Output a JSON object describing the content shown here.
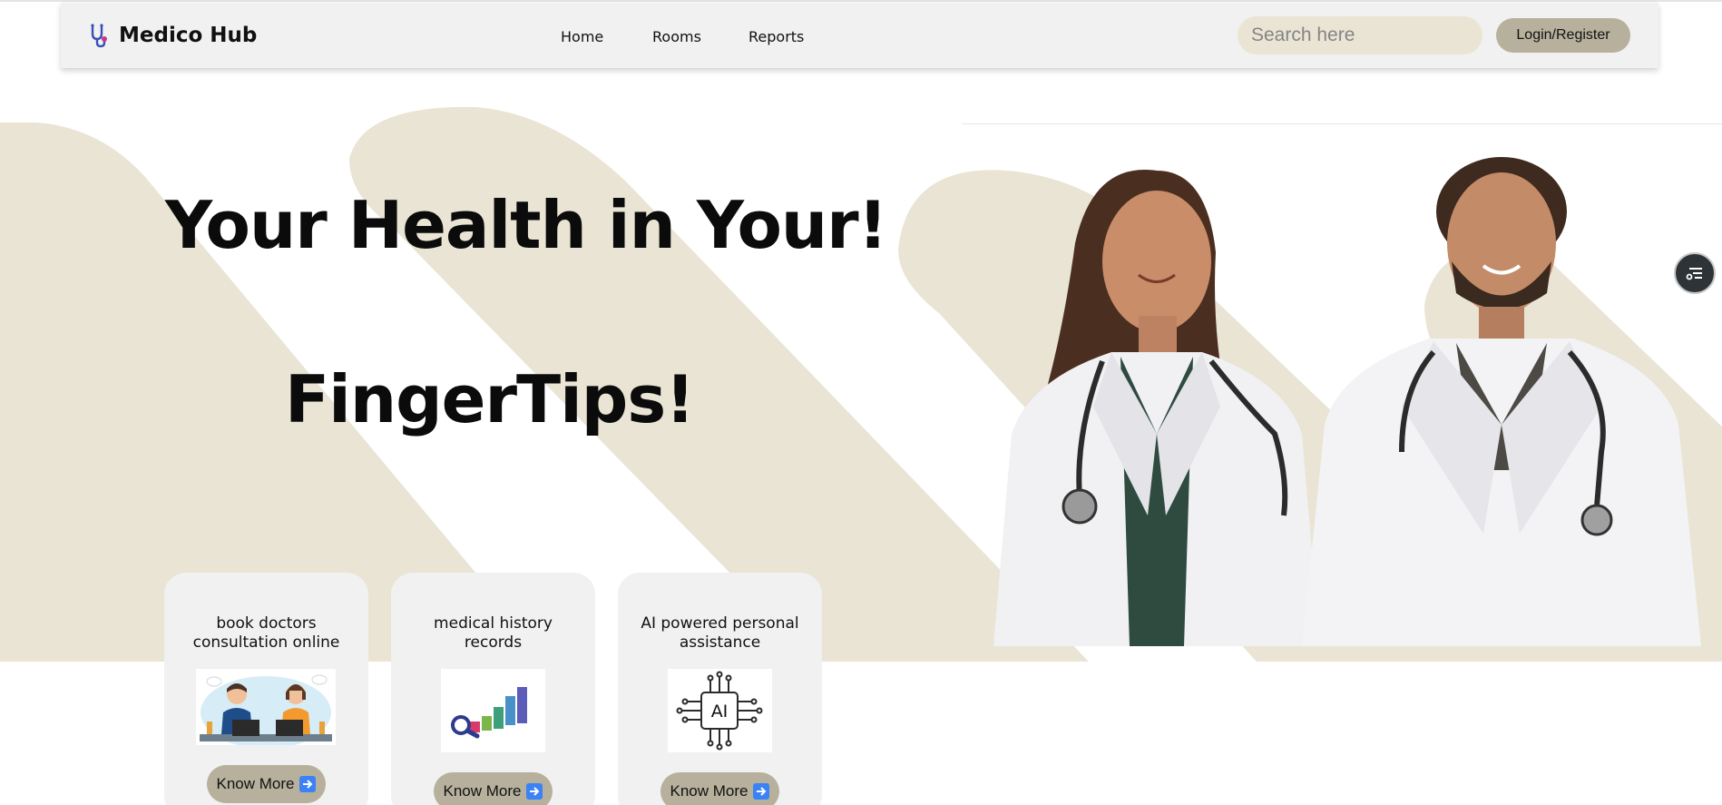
{
  "nav": {
    "brand": "Medico Hub",
    "links": [
      "Home",
      "Rooms",
      "Reports"
    ],
    "search_placeholder": "Search here",
    "login_label": "Login/Register"
  },
  "hero": {
    "headline_line1": "Your Health in Your!",
    "headline_line2": "FingerTips!"
  },
  "cards": [
    {
      "title": "book doctors consultation online",
      "button": "Know More",
      "icon": "doctors-consultation-illustration"
    },
    {
      "title": "medical history records",
      "button": "Know More",
      "icon": "bar-chart-magnifier-illustration"
    },
    {
      "title": "AI powered personal assistance",
      "button": "Know More",
      "icon": "ai-chip-icon"
    }
  ],
  "colors": {
    "accent": "#b6b09c",
    "band": "#e9e4d4",
    "nav_bg": "#f1f1f1",
    "card_bg": "#f1f1f1",
    "arrow_icon": "#3b82f6"
  }
}
